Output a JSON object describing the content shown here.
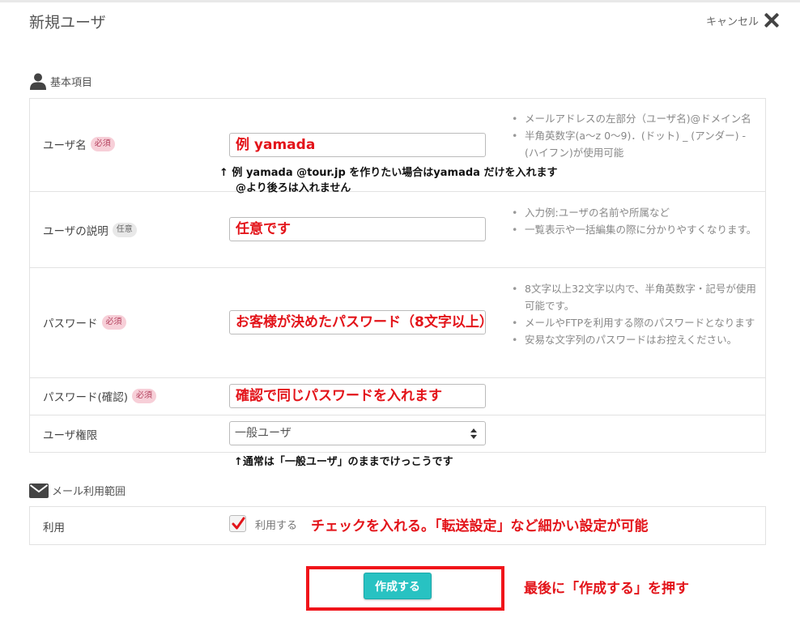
{
  "header": {
    "title": "新規ユーザ",
    "cancel_label": "キャンセル"
  },
  "basic_section": {
    "title": "基本項目",
    "rows": {
      "username": {
        "label": "ユーザ名",
        "badge": "必須",
        "value": "例 yamada",
        "hints": [
          "メールアドレスの左部分（ユーザ名)@ドメイン名",
          "半角英数字(a〜z 0〜9)．(ドット) _ (アンダー) - (ハイフン)が使用可能"
        ],
        "note_line1": "↑ 例 yamada @tour.jp を作りたい場合はyamada だけを入れます",
        "note_line2": "@より後ろは入れません"
      },
      "description": {
        "label": "ユーザの説明",
        "badge": "任意",
        "value": "任意です",
        "hints": [
          "入力例:ユーザの名前や所属など",
          "一覧表示や一括編集の際に分かりやすくなります。"
        ]
      },
      "password": {
        "label": "パスワード",
        "badge": "必須",
        "value": "お客様が決めたパスワード（8文字以上）",
        "hints": [
          "8文字以上32文字以内で、半角英数字・記号が使用可能です。",
          "メールやFTPを利用する際のパスワードとなります",
          "安易な文字列のパスワードはお控えください。"
        ]
      },
      "password_confirm": {
        "label": "パスワード(確認)",
        "badge": "必須",
        "value": "確認で同じパスワードを入れます"
      },
      "permission": {
        "label": "ユーザ権限",
        "selected": "一般ユーザ",
        "note": "↑通常は「一般ユーザ」のままでけっこうです"
      }
    }
  },
  "mail_section": {
    "title": "メール利用範囲",
    "row": {
      "label": "利用",
      "checkbox_label": "利用する",
      "checked": true,
      "note": "チェックを入れる。「転送設定」など細かい設定が可能"
    }
  },
  "footer": {
    "create_label": "作成する",
    "note": "最後に「作成する」を押す"
  },
  "colors": {
    "accent": "#28c2c2",
    "annotation_red": "#e3141a",
    "required_badge": "#f7cfd8"
  }
}
